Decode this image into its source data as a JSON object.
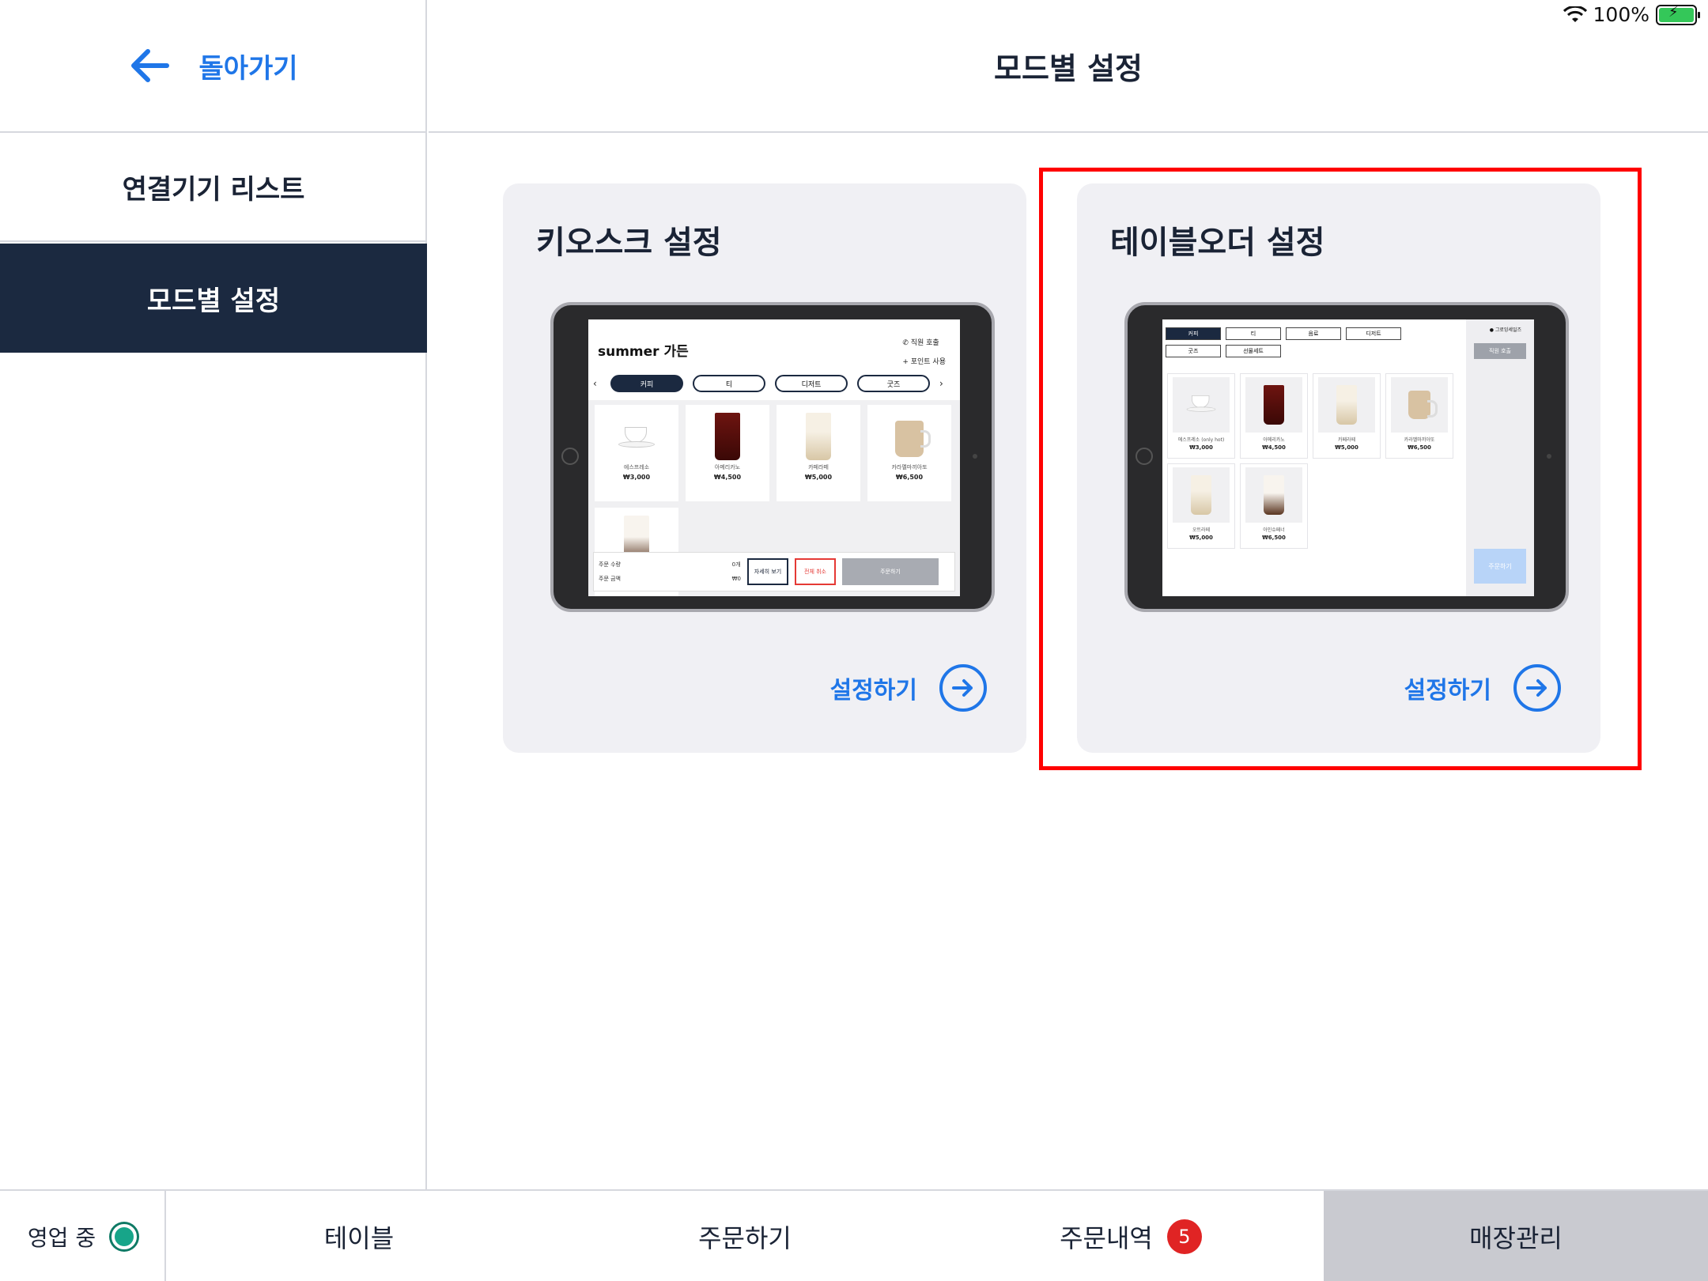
{
  "status_bar": {
    "battery_percent": "100%",
    "battery_level": 1.0
  },
  "sidebar": {
    "back_label": "돌아가기",
    "items": [
      {
        "label": "연결기기 리스트",
        "active": false
      },
      {
        "label": "모드별 설정",
        "active": true
      }
    ]
  },
  "header": {
    "title": "모드별 설정"
  },
  "cards": [
    {
      "title": "키오스크 설정",
      "cta": "설정하기",
      "preview": {
        "shop_name": "summer 가든",
        "call_staff": "직원 호출",
        "use_points": "포인트 사용",
        "tabs": [
          "커피",
          "티",
          "디저트",
          "굿즈"
        ],
        "items": [
          {
            "name": "에스프레소",
            "price": "₩3,000"
          },
          {
            "name": "아메리카노",
            "price": "₩4,500"
          },
          {
            "name": "카페라떼",
            "price": "₩5,000"
          },
          {
            "name": "카라멜마끼아또",
            "price": "₩6,500"
          }
        ],
        "order_qty_label": "주문 수량",
        "order_qty_value": "0개",
        "order_amount_label": "주문 금액",
        "order_amount_value": "₩0",
        "detail_button": "자세히 보기",
        "cancel_button": "전체 취소",
        "order_button": "주문하기"
      }
    },
    {
      "title": "테이블오더 설정",
      "cta": "설정하기",
      "highlighted": true,
      "preview": {
        "tabs": [
          "커피",
          "티",
          "음료",
          "디저트",
          "굿즈",
          "선물세트"
        ],
        "brand": "그로잉세일즈",
        "call_staff": "직원 호출",
        "items": [
          {
            "name": "에스프레소 (only hot)",
            "price": "₩3,000"
          },
          {
            "name": "아메리카노",
            "price": "₩4,500"
          },
          {
            "name": "카페라떼",
            "price": "₩5,000"
          },
          {
            "name": "카라멜마끼아또",
            "price": "₩6,500"
          },
          {
            "name": "오트라떼",
            "price": "₩5,000"
          },
          {
            "name": "아인슈페너",
            "price": "₩6,500"
          }
        ],
        "order_button": "주문하기"
      }
    }
  ],
  "tabbar": {
    "status_label": "영업 중",
    "items": [
      {
        "label": "테이블"
      },
      {
        "label": "주문하기"
      },
      {
        "label": "주문내역",
        "badge": "5"
      },
      {
        "label": "매장관리",
        "active": true
      }
    ]
  },
  "colors": {
    "accent": "#1f76e8",
    "navy": "#1b2940",
    "highlight": "#ff0000",
    "status_on": "#17a589",
    "badge": "#e02424"
  }
}
